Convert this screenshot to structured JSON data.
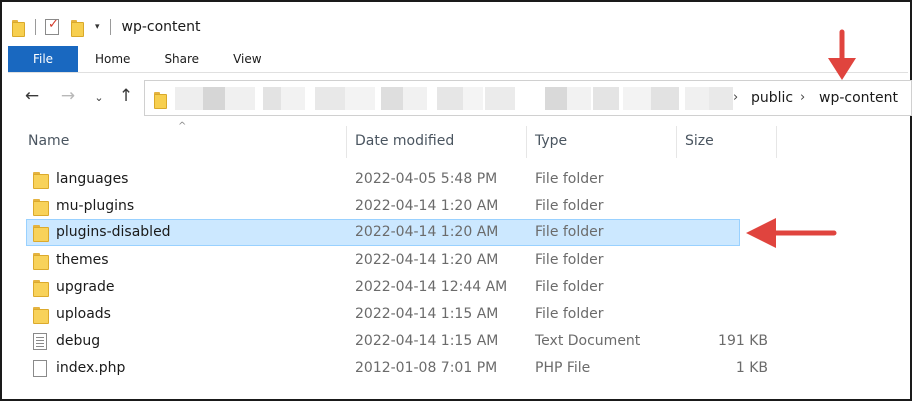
{
  "window": {
    "title": "wp-content",
    "dropdown_glyph": "▾"
  },
  "ribbon": {
    "tabs": [
      "File",
      "Home",
      "Share",
      "View"
    ]
  },
  "nav": {
    "back": "←",
    "forward": "→",
    "recent": "⌄",
    "up": "↑"
  },
  "address": {
    "crumbs": [
      "public",
      "wp-content"
    ],
    "separator": "›"
  },
  "columns": {
    "name": "Name",
    "date": "Date modified",
    "type": "Type",
    "size": "Size",
    "sort_glyph": "^"
  },
  "files": [
    {
      "name": "languages",
      "date": "2022-04-05 5:48 PM",
      "type": "File folder",
      "size": "",
      "icon": "folder-icon",
      "selected": false
    },
    {
      "name": "mu-plugins",
      "date": "2022-04-14 1:20 AM",
      "type": "File folder",
      "size": "",
      "icon": "folder-icon",
      "selected": false
    },
    {
      "name": "plugins-disabled",
      "date": "2022-04-14 1:20 AM",
      "type": "File folder",
      "size": "",
      "icon": "folder-icon",
      "selected": true
    },
    {
      "name": "themes",
      "date": "2022-04-14 1:20 AM",
      "type": "File folder",
      "size": "",
      "icon": "folder-icon",
      "selected": false
    },
    {
      "name": "upgrade",
      "date": "2022-04-14 12:44 AM",
      "type": "File folder",
      "size": "",
      "icon": "folder-icon",
      "selected": false
    },
    {
      "name": "uploads",
      "date": "2022-04-14 1:15 AM",
      "type": "File folder",
      "size": "",
      "icon": "folder-icon",
      "selected": false
    },
    {
      "name": "debug",
      "date": "2022-04-14 1:15 AM",
      "type": "Text Document",
      "size": "191 KB",
      "icon": "text-document-icon",
      "selected": false
    },
    {
      "name": "index.php",
      "date": "2012-01-08 7:01 PM",
      "type": "PHP File",
      "size": "1 KB",
      "icon": "file-icon",
      "selected": false
    }
  ],
  "colors": {
    "file_tab": "#1968c0",
    "selection": "#cce8ff",
    "selection_border": "#99d1ff",
    "folder": "#f8d25a",
    "annotation_arrow": "#e0443e"
  }
}
